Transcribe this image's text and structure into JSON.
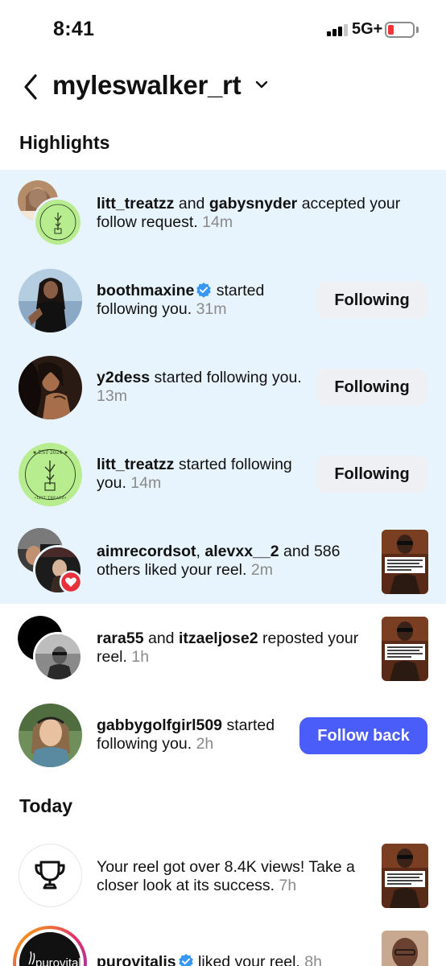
{
  "status_bar": {
    "time": "8:41",
    "network": "5G+"
  },
  "header": {
    "username": "myleswalker_rt"
  },
  "sections": {
    "highlights": "Highlights",
    "today": "Today"
  },
  "colors": {
    "highlight_bg": "#e8f4fd",
    "follow_back": "#4a5df9",
    "following_btn": "#eff0f3",
    "verified": "#3897f0",
    "time_text": "#8a8a8a"
  },
  "notifications": [
    {
      "user1": "litt_treatzz",
      "mid": " and ",
      "user2": "gabysnyder",
      "text": " accepted your follow request.",
      "time": "14m"
    },
    {
      "user1": "boothmaxine",
      "verified": true,
      "text": " started following you.",
      "time": "31m",
      "button": "Following"
    },
    {
      "user1": "y2dess",
      "text": " started following you.",
      "time": "13m",
      "button": "Following"
    },
    {
      "user1": "litt_treatzz",
      "text": " started following you.",
      "time": "14m",
      "button": "Following"
    },
    {
      "user1": "aimrecordsot",
      "mid": ", ",
      "user2": "alevxx__2",
      "text": " and 586 others liked your reel.",
      "time": "2m"
    },
    {
      "user1": "rara55",
      "mid": " and ",
      "user2": "itzaeljose2",
      "text": " reposted your reel.",
      "time": "1h"
    },
    {
      "user1": "gabbygolfgirl509",
      "text": " started following you.",
      "time": "2h",
      "button": "Follow back"
    }
  ],
  "today": [
    {
      "text": "Your reel got over 8.4K views! Take a closer look at its success.",
      "time": "7h",
      "icon": "trophy-icon"
    },
    {
      "user1": "purovitalis",
      "verified": true,
      "text": " liked your reel.",
      "time": "8h"
    }
  ],
  "logos": {
    "litt_treatzz_ring": "LITT TREATZZ",
    "puro": "purovitalis"
  }
}
